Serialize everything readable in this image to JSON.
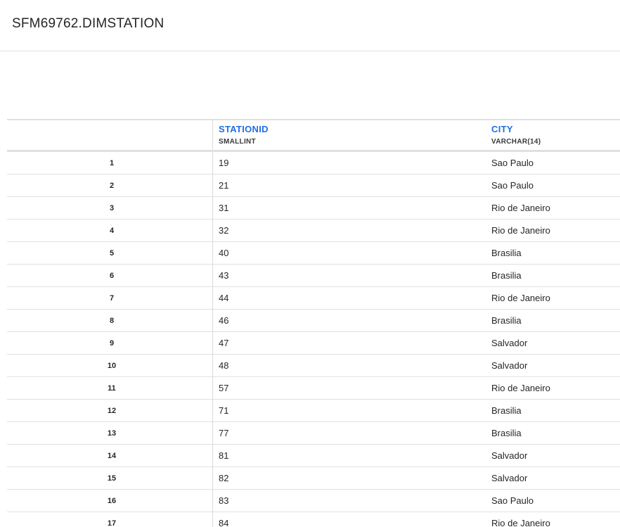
{
  "title": "SFM69762.DIMSTATION",
  "columns": [
    {
      "name": "STATIONID",
      "type": "SMALLINT"
    },
    {
      "name": "CITY",
      "type": "VARCHAR(14)"
    }
  ],
  "accent_color": "#1f6fe5",
  "rows": [
    {
      "index": "1",
      "stationid": "19",
      "city": "Sao Paulo"
    },
    {
      "index": "2",
      "stationid": "21",
      "city": "Sao Paulo"
    },
    {
      "index": "3",
      "stationid": "31",
      "city": "Rio de Janeiro"
    },
    {
      "index": "4",
      "stationid": "32",
      "city": "Rio de Janeiro"
    },
    {
      "index": "5",
      "stationid": "40",
      "city": "Brasilia"
    },
    {
      "index": "6",
      "stationid": "43",
      "city": "Brasilia"
    },
    {
      "index": "7",
      "stationid": "44",
      "city": "Rio de Janeiro"
    },
    {
      "index": "8",
      "stationid": "46",
      "city": "Brasilia"
    },
    {
      "index": "9",
      "stationid": "47",
      "city": "Salvador"
    },
    {
      "index": "10",
      "stationid": "48",
      "city": "Salvador"
    },
    {
      "index": "11",
      "stationid": "57",
      "city": "Rio de Janeiro"
    },
    {
      "index": "12",
      "stationid": "71",
      "city": "Brasilia"
    },
    {
      "index": "13",
      "stationid": "77",
      "city": "Brasilia"
    },
    {
      "index": "14",
      "stationid": "81",
      "city": "Salvador"
    },
    {
      "index": "15",
      "stationid": "82",
      "city": "Salvador"
    },
    {
      "index": "16",
      "stationid": "83",
      "city": "Sao Paulo"
    },
    {
      "index": "17",
      "stationid": "84",
      "city": "Rio de Janeiro"
    }
  ]
}
